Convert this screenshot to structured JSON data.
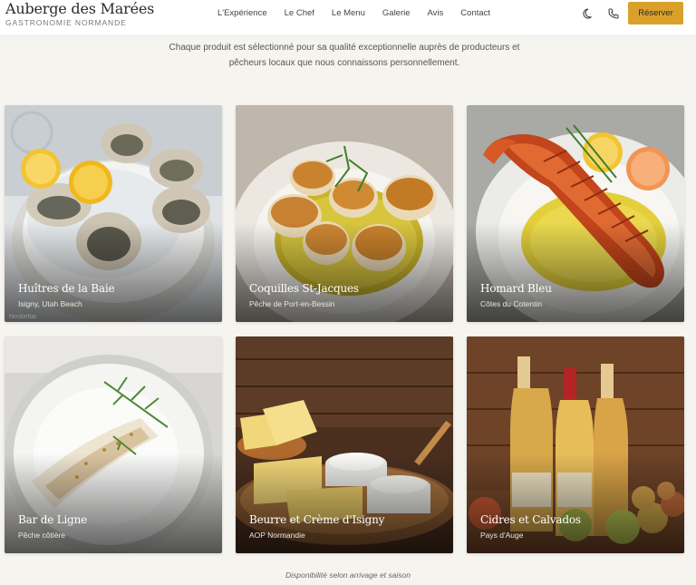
{
  "brand": {
    "title": "Auberge des Marées",
    "subtitle": "GASTRONOMIE NORMANDE"
  },
  "nav": {
    "links": [
      "L'Expérience",
      "Le Chef",
      "Le Menu",
      "Galerie",
      "Avis",
      "Contact"
    ],
    "theme_icon": "moon-icon",
    "phone_icon": "phone-icon",
    "reserve_label": "Réserver"
  },
  "intro": {
    "line1": "Chaque produit est sélectionné pour sa qualité exceptionnelle auprès de producteurs et",
    "line2": "pêcheurs locaux que nous connaissons personnellement."
  },
  "products": [
    {
      "title": "Huîtres de la Baie",
      "subtitle": "Isigny, Utah Beach",
      "credit": "Noobettar",
      "image": "oysters-on-ice"
    },
    {
      "title": "Coquilles St-Jacques",
      "subtitle": "Pêche de Port-en-Bessin",
      "image": "seared-scallops"
    },
    {
      "title": "Homard Bleu",
      "subtitle": "Côtes du Cotentin",
      "image": "grilled-lobster"
    },
    {
      "title": "Bar de Ligne",
      "subtitle": "Pêche côtière",
      "image": "sea-bass-fillet"
    },
    {
      "title": "Beurre et Crème d'Isigny",
      "subtitle": "AOP Normandie",
      "image": "butter-and-cream"
    },
    {
      "title": "Cidres et Calvados",
      "subtitle": "Pays d'Auge",
      "image": "calvados-bottles"
    }
  ],
  "footer": {
    "note": "Disponibilité selon arrivage et saison"
  },
  "colors": {
    "accent": "#d9a12c",
    "background": "#f6f4ef",
    "nav_background": "#ffffff"
  }
}
